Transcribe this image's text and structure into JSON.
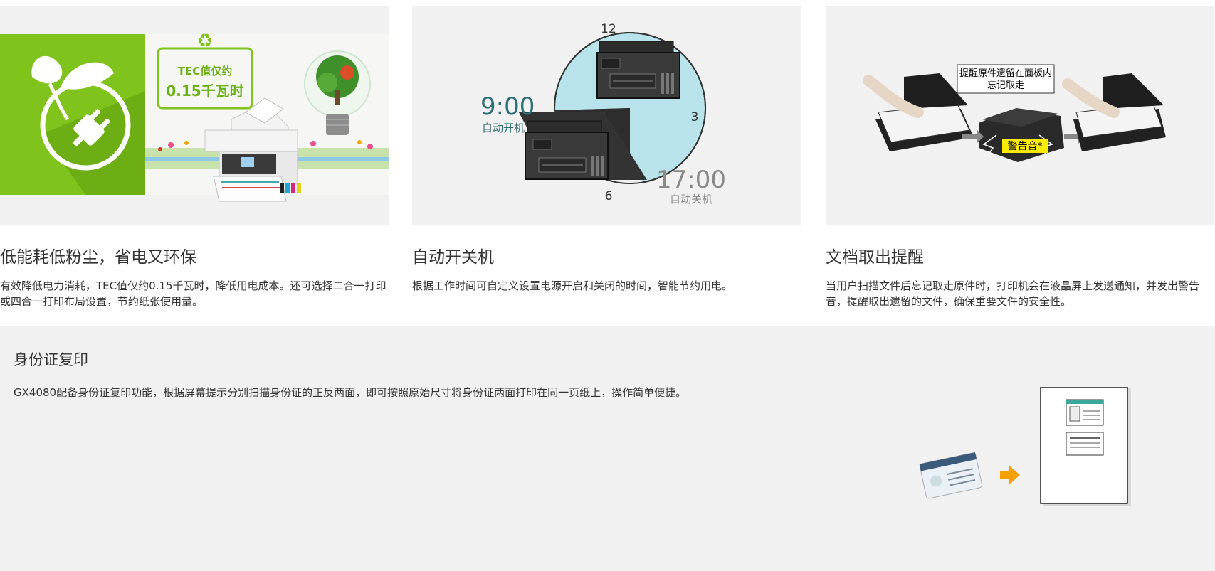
{
  "features": [
    {
      "title": "低能耗低粉尘，省电又环保",
      "desc": "有效降低电力消耗，TEC值仅约0.15千瓦时，降低用电成本。还可选择二合一打印或四合一打印布局设置，节约纸张使用量。",
      "image": {
        "badge_line1": "TEC值仅约",
        "badge_line2": "0.15千瓦时",
        "brand_color": "#7fc31c"
      }
    },
    {
      "title": "自动开关机",
      "desc": "根据工作时间可自定义设置电源开启和关闭的时间，智能节约用电。",
      "image": {
        "clock_12": "12",
        "clock_3": "3",
        "clock_6": "6",
        "on_time": "9:00",
        "on_label": "自动开机",
        "off_time": "17:00",
        "off_label": "自动关机"
      }
    },
    {
      "title": "文档取出提醒",
      "desc": "当用户扫描文件后忘记取走原件时，打印机会在液晶屏上发送通知，并发出警告音，提醒取出遗留的文件，确保重要文件的安全性。",
      "image": {
        "callout_line1": "提醒原件遗留在面板内",
        "callout_line2": "忘记取走",
        "alarm_label": "警告音*"
      }
    }
  ],
  "id_copy": {
    "title": "身份证复印",
    "desc": "GX4080配备身份证复印功能，根据屏幕提示分别扫描身份证的正反两面，即可按照原始尺寸将身份证两面打印在同一页纸上，操作简单便捷。"
  }
}
